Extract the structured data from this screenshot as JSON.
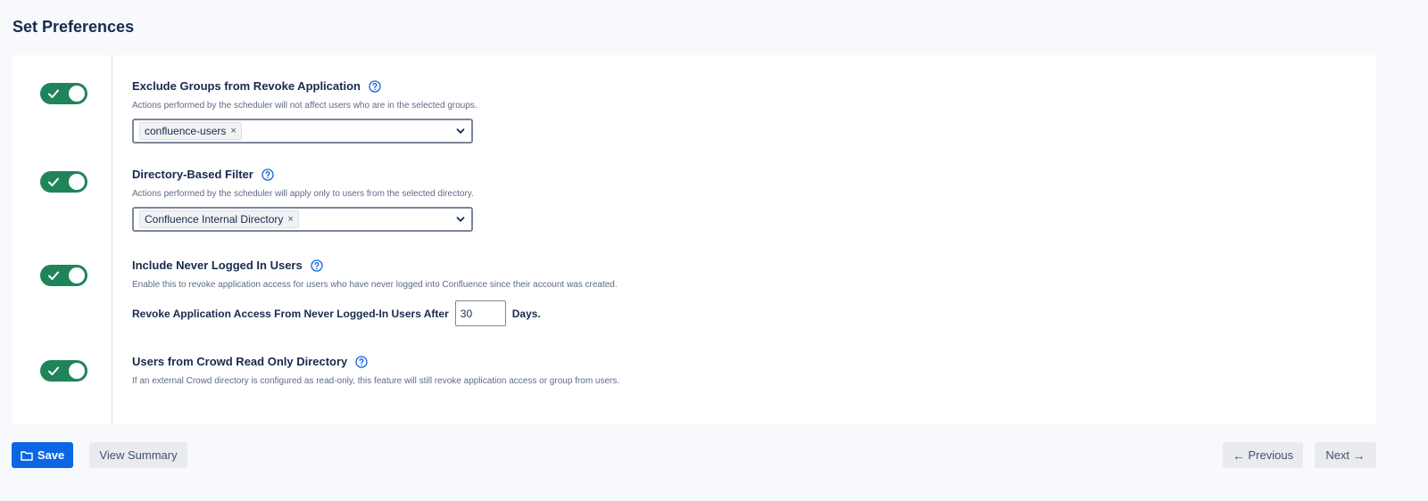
{
  "page": {
    "title": "Set Preferences"
  },
  "colors": {
    "toggle_on": "#1f845a",
    "primary": "#0c66e4",
    "help": "#0c66e4"
  },
  "sections": [
    {
      "title": "Exclude Groups from Revoke Application",
      "description": "Actions performed by the scheduler will not affect users who are in the selected groups.",
      "enabled": true,
      "selected": "confluence-users"
    },
    {
      "title": "Directory-Based Filter",
      "description": "Actions performed by the scheduler will apply only to users from the selected directory.",
      "enabled": true,
      "selected": "Confluence Internal Directory"
    },
    {
      "title": "Include Never Logged In Users",
      "description": "Enable this to revoke application access for users who have never logged into Confluence since their account was created.",
      "enabled": true,
      "inline_label_before": "Revoke Application Access From Never Logged-In Users After",
      "inline_value": "30",
      "inline_label_after": "Days."
    },
    {
      "title": "Users from Crowd Read Only Directory",
      "description": "If an external Crowd directory is configured as read-only, this feature will still revoke application access or group from users.",
      "enabled": true
    }
  ],
  "footer": {
    "save_label": "Save",
    "summary_label": "View Summary",
    "previous_label": "Previous",
    "next_label": "Next",
    "previous_arrow": "←",
    "next_arrow": "→"
  },
  "icons": {
    "tag_remove": "×",
    "help": "help-circle-icon",
    "check": "check-icon",
    "folder": "folder-icon",
    "chevron": "chevron-down-icon"
  }
}
